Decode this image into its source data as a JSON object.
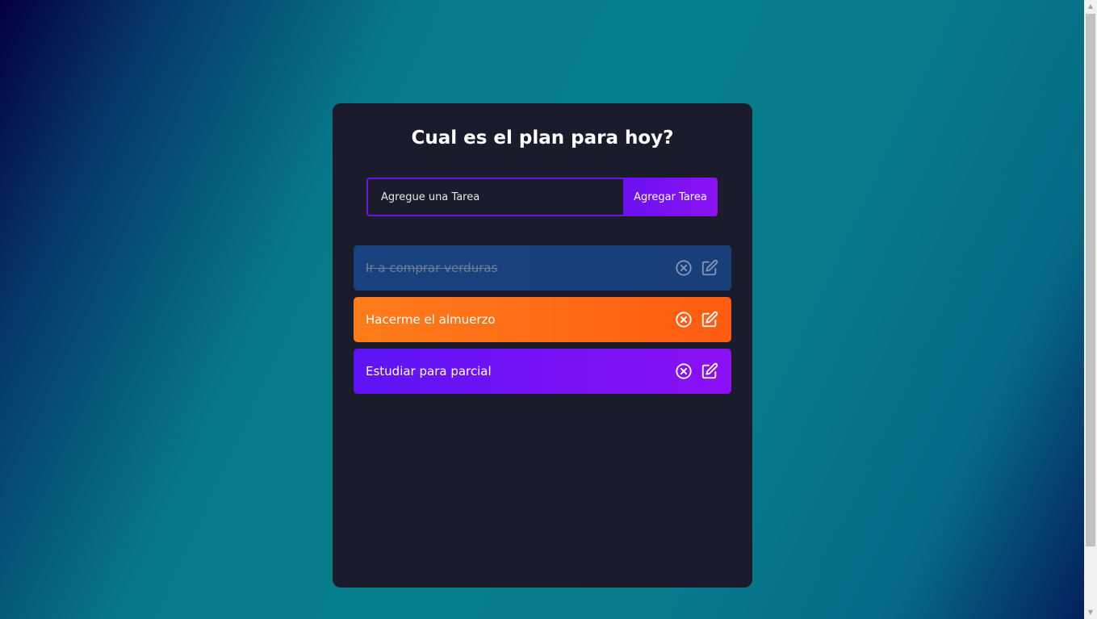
{
  "app": {
    "title": "Cual es el plan para hoy?"
  },
  "form": {
    "input_placeholder": "Agregue una Tarea",
    "input_value": "",
    "add_button_label": "Agregar Tarea"
  },
  "tasks": [
    {
      "text": "Ir a comprar verduras",
      "completed": true,
      "color": "#17427f"
    },
    {
      "text": "Hacerme el almuerzo",
      "completed": false,
      "color": "#ff6a16"
    },
    {
      "text": "Estudiar para parcial",
      "completed": false,
      "color": "#7212f5"
    }
  ],
  "icons": {
    "delete": "close-circle-icon",
    "edit": "edit-icon"
  },
  "colors": {
    "panel": "#1b1c2b",
    "accent": "#6b14e8"
  }
}
